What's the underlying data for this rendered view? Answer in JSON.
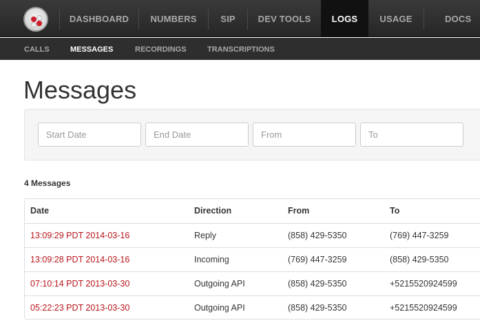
{
  "top_nav": {
    "items": [
      {
        "label": "DASHBOARD"
      },
      {
        "label": "NUMBERS"
      },
      {
        "label": "SIP"
      },
      {
        "label": "DEV TOOLS"
      },
      {
        "label": "LOGS",
        "active": true
      },
      {
        "label": "USAGE"
      },
      {
        "label": "DOCS"
      }
    ]
  },
  "sub_nav": {
    "items": [
      {
        "label": "CALLS"
      },
      {
        "label": "MESSAGES",
        "active": true
      },
      {
        "label": "RECORDINGS"
      },
      {
        "label": "TRANSCRIPTIONS"
      }
    ]
  },
  "page": {
    "title": "Messages"
  },
  "filters": {
    "start_date_placeholder": "Start Date",
    "end_date_placeholder": "End Date",
    "from_placeholder": "From",
    "to_placeholder": "To"
  },
  "results": {
    "count_label": "4 Messages"
  },
  "table": {
    "headers": [
      "Date",
      "Direction",
      "From",
      "To"
    ],
    "rows": [
      {
        "date": "13:09:29 PDT 2014-03-16",
        "direction": "Reply",
        "from": "(858) 429-5350",
        "to": "(769) 447-3259"
      },
      {
        "date": "13:09:28 PDT 2014-03-16",
        "direction": "Incoming",
        "from": "(769) 447-3259",
        "to": "(858) 429-5350"
      },
      {
        "date": "07:10:14 PDT 2013-03-30",
        "direction": "Outgoing API",
        "from": "(858) 429-5350",
        "to": "+5215520924599"
      },
      {
        "date": "05:22:23 PDT 2013-03-30",
        "direction": "Outgoing API",
        "from": "(858) 429-5350",
        "to": "+5215520924599"
      }
    ]
  },
  "colors": {
    "date_link": "#b8141a",
    "nav_background": "#2e2e2e",
    "nav_active": "#111111"
  }
}
